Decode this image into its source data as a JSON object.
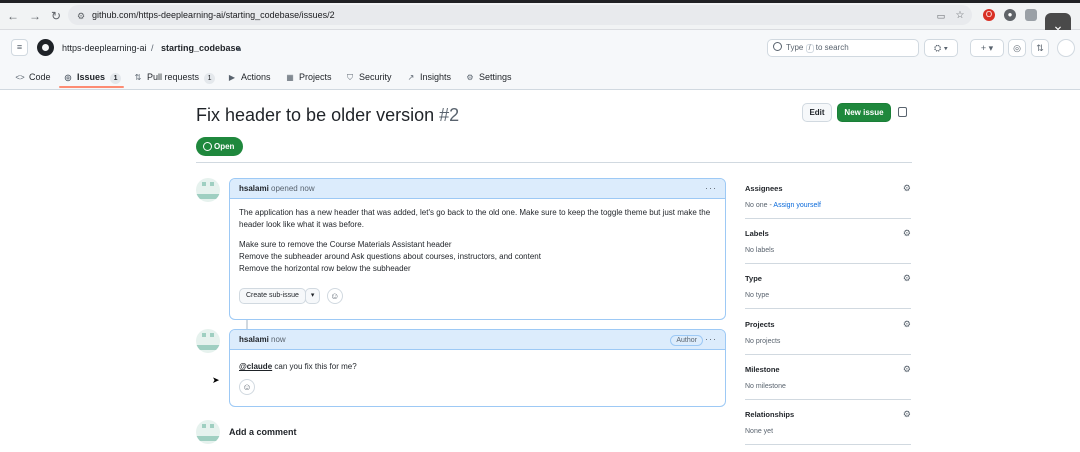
{
  "browser": {
    "url": "github.com/https-deeplearning-ai/starting_codebase/issues/2"
  },
  "header": {
    "owner": "https-deeplearning-ai",
    "separator": "/",
    "repo": "starting_codebase",
    "search_placeholder_pre": "Type",
    "search_key": "/",
    "search_placeholder_post": "to search"
  },
  "tabs": [
    {
      "label": "Code",
      "icon": "code-icon"
    },
    {
      "label": "Issues",
      "count": "1",
      "icon": "issue-icon"
    },
    {
      "label": "Pull requests",
      "count": "1",
      "icon": "pull-request-icon"
    },
    {
      "label": "Actions",
      "icon": "play-icon"
    },
    {
      "label": "Projects",
      "icon": "table-icon"
    },
    {
      "label": "Security",
      "icon": "shield-icon"
    },
    {
      "label": "Insights",
      "icon": "graph-icon"
    },
    {
      "label": "Settings",
      "icon": "gear-icon"
    }
  ],
  "issue": {
    "title": "Fix header to be older version",
    "number": "#2",
    "state": "Open",
    "edit_label": "Edit",
    "new_issue_label": "New issue"
  },
  "comments": [
    {
      "author": "hsalami",
      "meta": "opened now",
      "paragraph1": "The application has a new header that was added, let's go back to the old one. Make sure to keep the toggle theme but just make the header look like what it was before.",
      "line1": "Make sure to remove the Course Materials Assistant header",
      "line2": "Remove the subheader around Ask questions about courses, instructors, and content",
      "line3": "Remove the horizontal row below the subheader",
      "sub_issue_label": "Create sub-issue"
    },
    {
      "author": "hsalami",
      "meta": "now",
      "badge": "Author",
      "mention": "@claude",
      "text": "can you fix this for me?"
    }
  ],
  "add_comment_label": "Add a comment",
  "sidebar": {
    "assignees": {
      "label": "Assignees",
      "value": "No one -",
      "link": "Assign yourself"
    },
    "labels": {
      "label": "Labels",
      "value": "No labels"
    },
    "type": {
      "label": "Type",
      "value": "No type"
    },
    "projects": {
      "label": "Projects",
      "value": "No projects"
    },
    "milestone": {
      "label": "Milestone",
      "value": "No milestone"
    },
    "relationships": {
      "label": "Relationships",
      "value": "None yet"
    }
  },
  "colors": {
    "accent_green": "#1f883d",
    "link_blue": "#0969da",
    "tab_underline": "#fd8c73"
  }
}
